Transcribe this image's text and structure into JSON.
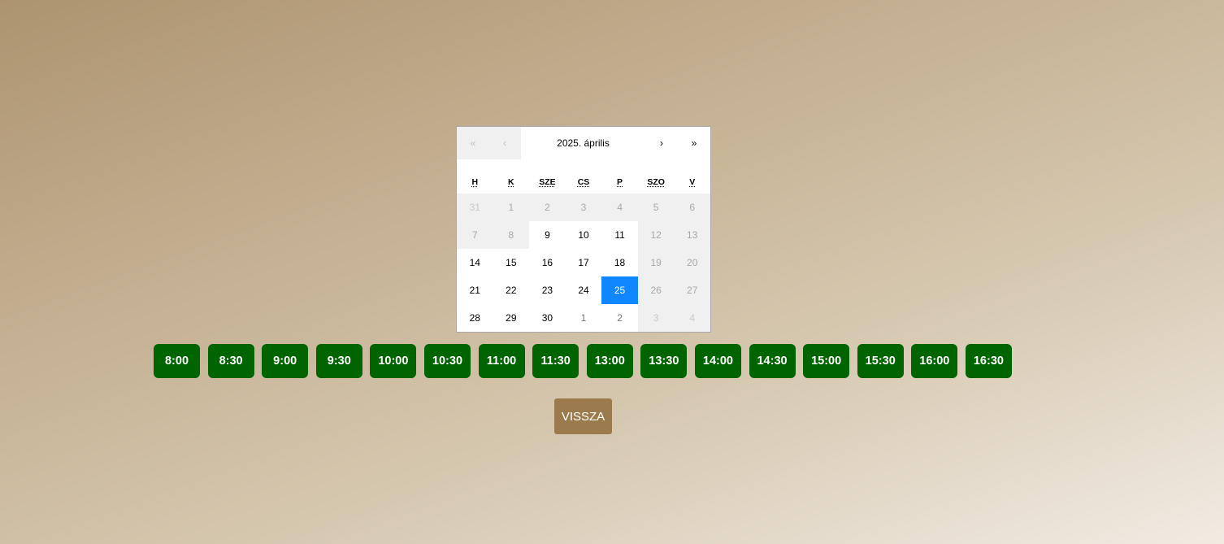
{
  "calendar": {
    "nav": {
      "prev_year": "«",
      "prev_month": "‹",
      "label": "2025. április",
      "next_month": "›",
      "next_year": "»"
    },
    "weekdays": [
      "H",
      "K",
      "SZE",
      "CS",
      "P",
      "SZO",
      "V"
    ],
    "days": [
      {
        "label": "31",
        "state": "off",
        "neighbor": true
      },
      {
        "label": "1",
        "state": "off",
        "neighbor": false
      },
      {
        "label": "2",
        "state": "off",
        "neighbor": false
      },
      {
        "label": "3",
        "state": "off",
        "neighbor": false
      },
      {
        "label": "4",
        "state": "off",
        "neighbor": false
      },
      {
        "label": "5",
        "state": "off",
        "neighbor": false
      },
      {
        "label": "6",
        "state": "off",
        "neighbor": false
      },
      {
        "label": "7",
        "state": "off",
        "neighbor": false
      },
      {
        "label": "8",
        "state": "off",
        "neighbor": false
      },
      {
        "label": "9",
        "state": "on",
        "neighbor": false
      },
      {
        "label": "10",
        "state": "on",
        "neighbor": false
      },
      {
        "label": "11",
        "state": "on",
        "neighbor": false
      },
      {
        "label": "12",
        "state": "off",
        "neighbor": false
      },
      {
        "label": "13",
        "state": "off",
        "neighbor": false
      },
      {
        "label": "14",
        "state": "on",
        "neighbor": false
      },
      {
        "label": "15",
        "state": "on",
        "neighbor": false
      },
      {
        "label": "16",
        "state": "on",
        "neighbor": false
      },
      {
        "label": "17",
        "state": "on",
        "neighbor": false
      },
      {
        "label": "18",
        "state": "on",
        "neighbor": false
      },
      {
        "label": "19",
        "state": "off",
        "neighbor": false
      },
      {
        "label": "20",
        "state": "off",
        "neighbor": false
      },
      {
        "label": "21",
        "state": "on",
        "neighbor": false
      },
      {
        "label": "22",
        "state": "on",
        "neighbor": false
      },
      {
        "label": "23",
        "state": "on",
        "neighbor": false
      },
      {
        "label": "24",
        "state": "on",
        "neighbor": false
      },
      {
        "label": "25",
        "state": "selected",
        "neighbor": false
      },
      {
        "label": "26",
        "state": "off",
        "neighbor": false
      },
      {
        "label": "27",
        "state": "off",
        "neighbor": false
      },
      {
        "label": "28",
        "state": "on",
        "neighbor": false
      },
      {
        "label": "29",
        "state": "on",
        "neighbor": false
      },
      {
        "label": "30",
        "state": "on",
        "neighbor": false
      },
      {
        "label": "1",
        "state": "on",
        "neighbor": true
      },
      {
        "label": "2",
        "state": "on",
        "neighbor": true
      },
      {
        "label": "3",
        "state": "off",
        "neighbor": true
      },
      {
        "label": "4",
        "state": "off",
        "neighbor": true
      }
    ]
  },
  "time_slots": [
    "8:00",
    "8:30",
    "9:00",
    "9:30",
    "10:00",
    "10:30",
    "11:00",
    "11:30",
    "13:00",
    "13:30",
    "14:00",
    "14:30",
    "15:00",
    "15:30",
    "16:00",
    "16:30"
  ],
  "back_button": "VISSZA",
  "colors": {
    "slot_bg": "#006400",
    "selected_day": "#1187ff",
    "back_button_bg": "#9b7b4d"
  }
}
